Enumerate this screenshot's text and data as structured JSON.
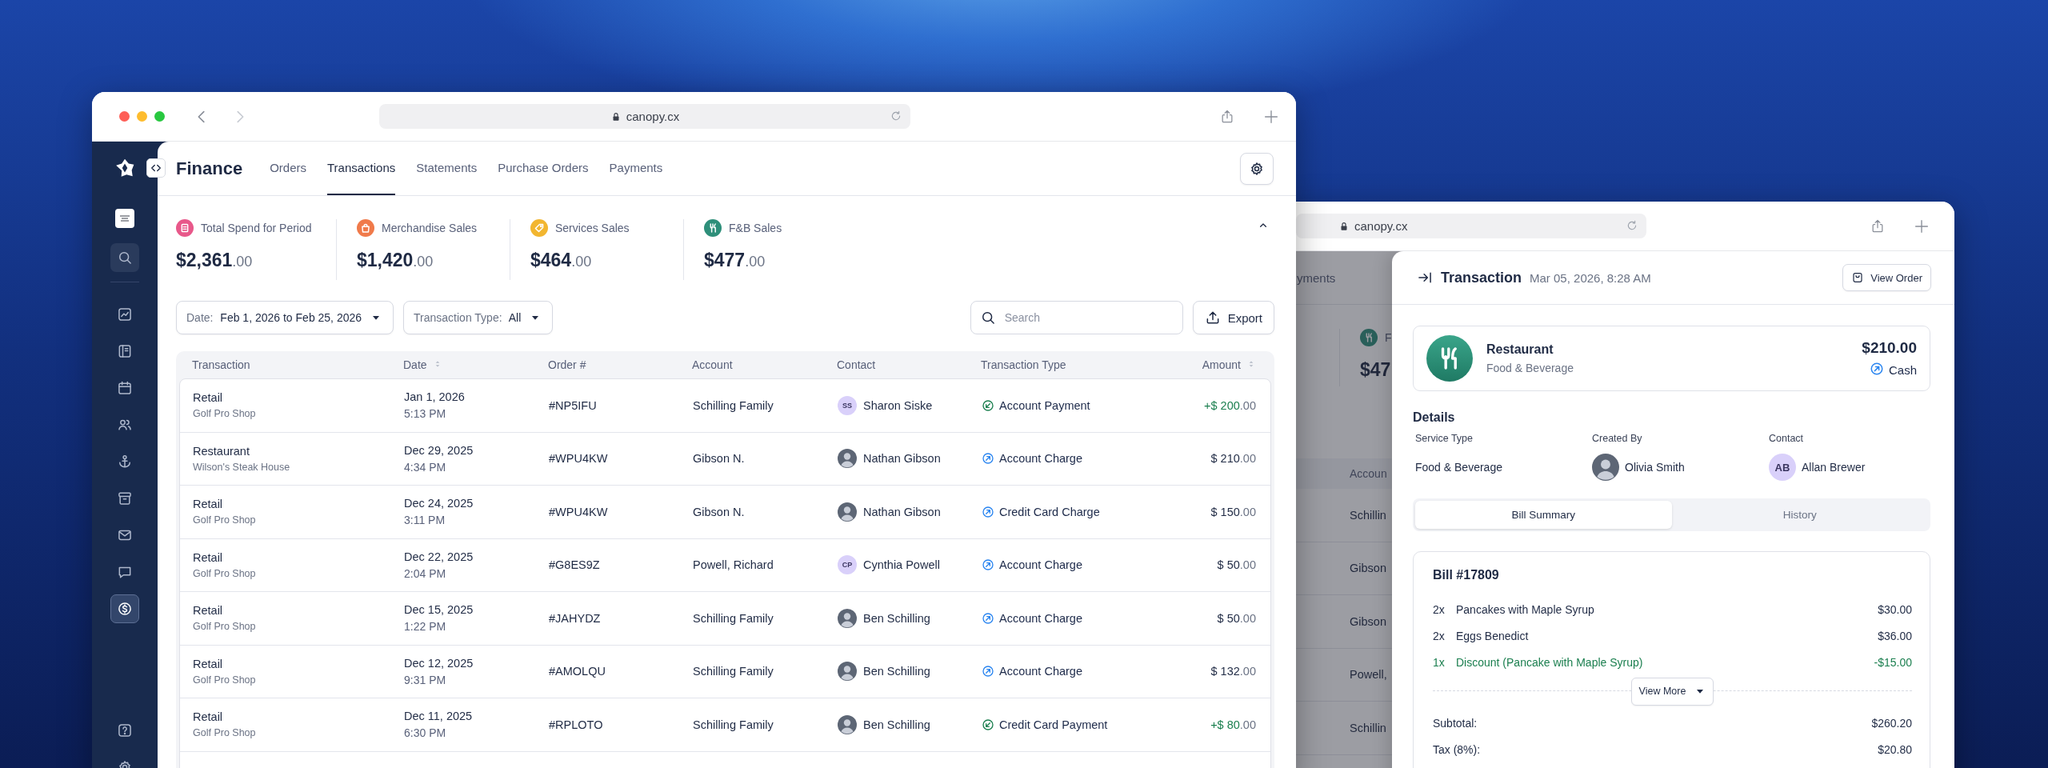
{
  "main_window": {
    "address": "canopy.cx",
    "sidebar": {
      "items": [
        {
          "selected": false
        },
        {
          "selected": false
        },
        {
          "selected": false
        },
        {
          "selected": false
        },
        {
          "selected": false
        },
        {
          "selected": false
        },
        {
          "selected": false
        },
        {
          "selected": false
        },
        {
          "selected": true
        }
      ]
    },
    "page_title": "Finance",
    "tabs": [
      {
        "label": "Orders",
        "selected": false
      },
      {
        "label": "Transactions",
        "selected": true
      },
      {
        "label": "Statements",
        "selected": false
      },
      {
        "label": "Purchase Orders",
        "selected": false
      },
      {
        "label": "Payments",
        "selected": false
      }
    ],
    "stats": [
      {
        "label": "Total Spend for Period",
        "amount": "$2,361",
        "cents": ".00",
        "kind": "receipt",
        "color": "#e8588a"
      },
      {
        "label": "Merchandise Sales",
        "amount": "$1,420",
        "cents": ".00",
        "kind": "bag",
        "color": "#f07a4a"
      },
      {
        "label": "Services Sales",
        "amount": "$464",
        "cents": ".00",
        "kind": "tag",
        "color": "#f2b630"
      },
      {
        "label": "F&B Sales",
        "amount": "$477",
        "cents": ".00",
        "kind": "utensils",
        "color": "#2e8f7a"
      }
    ],
    "filters": [
      {
        "label": "Date:",
        "value": "Feb 1, 2026 to Feb 25, 2026"
      },
      {
        "label": "Transaction Type:",
        "value": "All"
      }
    ],
    "search": {
      "placeholder": "Search"
    },
    "export_button": "Export",
    "table": {
      "columns": [
        {
          "label": "Transaction",
          "sortable": false
        },
        {
          "label": "Date",
          "sortable": true
        },
        {
          "label": "Order #",
          "sortable": false
        },
        {
          "label": "Account",
          "sortable": false
        },
        {
          "label": "Contact",
          "sortable": false
        },
        {
          "label": "Transaction Type",
          "sortable": false
        },
        {
          "label": "Amount",
          "sortable": true
        }
      ],
      "rows": [
        {
          "transaction": "Retail",
          "location": "Golf Pro Shop",
          "date": "Jan 1, 2026",
          "time": "5:13 PM",
          "order": "#NP5IFU",
          "account": "Schilling Family",
          "contact": {
            "name": "Sharon Siske",
            "kind": "initials",
            "initials": "SS"
          },
          "type": {
            "label": "Account Payment",
            "kind": "payment"
          },
          "amount": "+$ 200",
          "cents": ".00"
        },
        {
          "transaction": "Restaurant",
          "location": "Wilson's Steak House",
          "date": "Dec 29, 2025",
          "time": "4:34 PM",
          "order": "#WPU4KW",
          "account": "Gibson N.",
          "contact": {
            "name": "Nathan Gibson",
            "kind": "photo"
          },
          "type": {
            "label": "Account Charge",
            "kind": "charge"
          },
          "amount": "$ 210",
          "cents": ".00"
        },
        {
          "transaction": "Retail",
          "location": "Golf Pro Shop",
          "date": "Dec 24, 2025",
          "time": "3:11 PM",
          "order": "#WPU4KW",
          "account": "Gibson N.",
          "contact": {
            "name": "Nathan Gibson",
            "kind": "photo"
          },
          "type": {
            "label": "Credit Card Charge",
            "kind": "charge"
          },
          "amount": "$ 150",
          "cents": ".00"
        },
        {
          "transaction": "Retail",
          "location": "Golf Pro Shop",
          "date": "Dec 22, 2025",
          "time": "2:04 PM",
          "order": "#G8ES9Z",
          "account": "Powell, Richard",
          "contact": {
            "name": "Cynthia Powell",
            "kind": "initials",
            "initials": "CP"
          },
          "type": {
            "label": "Account Charge",
            "kind": "charge"
          },
          "amount": "$ 50",
          "cents": ".00"
        },
        {
          "transaction": "Retail",
          "location": "Golf Pro Shop",
          "date": "Dec 15, 2025",
          "time": "1:22 PM",
          "order": "#JAHYDZ",
          "account": "Schilling Family",
          "contact": {
            "name": "Ben Schilling",
            "kind": "photo"
          },
          "type": {
            "label": "Account Charge",
            "kind": "charge"
          },
          "amount": "$ 50",
          "cents": ".00"
        },
        {
          "transaction": "Retail",
          "location": "Golf Pro Shop",
          "date": "Dec 12, 2025",
          "time": "9:31 PM",
          "order": "#AMOLQU",
          "account": "Schilling Family",
          "contact": {
            "name": "Ben Schilling",
            "kind": "photo"
          },
          "type": {
            "label": "Account Charge",
            "kind": "charge"
          },
          "amount": "$ 132",
          "cents": ".00"
        },
        {
          "transaction": "Retail",
          "location": "Golf Pro Shop",
          "date": "Dec 11, 2025",
          "time": "6:30 PM",
          "order": "#RPLOTO",
          "account": "Schilling Family",
          "contact": {
            "name": "Ben Schilling",
            "kind": "photo"
          },
          "type": {
            "label": "Credit Card Payment",
            "kind": "payment"
          },
          "amount": "+$ 80",
          "cents": ".00"
        }
      ]
    }
  },
  "detail_window": {
    "address": "canopy.cx",
    "background_page": {
      "tab": "yments",
      "stat_label": "F",
      "stat_amount": "$47",
      "column": "Accoun",
      "rows": [
        "Schillin",
        "Gibson",
        "Gibson",
        "Powell,",
        "Schillin"
      ]
    },
    "drawer": {
      "title": "Transaction",
      "timestamp": "Mar 05, 2026, 8:28 AM",
      "view_order": "View Order",
      "summary": {
        "category": "Restaurant",
        "subcategory": "Food & Beverage",
        "amount": "$210.00",
        "method": "Cash"
      },
      "details_heading": "Details",
      "fields": [
        {
          "label": "Service Type",
          "value": "Food & Beverage"
        },
        {
          "label": "Created By",
          "value": "Olivia Smith",
          "avatar": {
            "kind": "photo"
          }
        },
        {
          "label": "Contact",
          "value": "Allan Brewer",
          "avatar": {
            "kind": "initials",
            "initials": "AB"
          }
        }
      ],
      "tabs": [
        {
          "label": "Bill Summary",
          "selected": true
        },
        {
          "label": "History",
          "selected": false
        }
      ],
      "bill": {
        "title": "Bill #17809",
        "items": [
          {
            "qty": "2x",
            "name": "Pancakes with Maple Syrup",
            "price": "$30.00",
            "kind": "item"
          },
          {
            "qty": "2x",
            "name": "Eggs Benedict",
            "price": "$36.00",
            "kind": "item"
          },
          {
            "qty": "1x",
            "name": "Discount (Pancake with Maple Syrup)",
            "price": "-$15.00",
            "kind": "discount"
          }
        ],
        "view_more": "View More",
        "totals": [
          {
            "label": "Subtotal:",
            "value": "$260.20"
          },
          {
            "label": "Tax (8%):",
            "value": "$20.80"
          }
        ]
      }
    }
  }
}
